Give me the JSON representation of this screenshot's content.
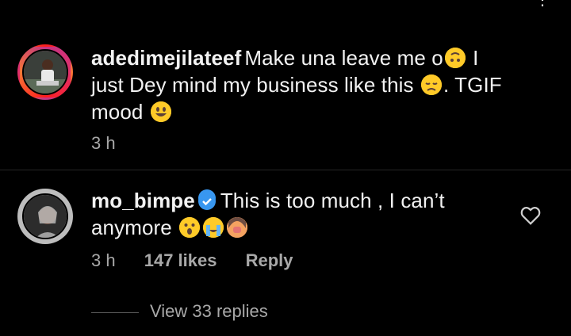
{
  "comments": [
    {
      "username": "adedimejilateef",
      "text_part1": "Make una leave me o",
      "text_part2": " I just Dey mind my business like this ",
      "text_part3": ". TGIF mood ",
      "time": "3 h"
    },
    {
      "username": "mo_bimpe",
      "verified": true,
      "text_part1": "This is too much , I can’t anymore ",
      "time": "3 h",
      "likes": "147 likes",
      "reply": "Reply"
    }
  ],
  "view_replies": "View 33 replies",
  "icons": {
    "menu": "more-icon",
    "like": "heart-icon",
    "verified": "verified-badge-icon"
  },
  "colors": {
    "background": "#000000",
    "text": "#f2f2f2",
    "secondary": "#a8a8a8",
    "verified": "#3897f0"
  }
}
